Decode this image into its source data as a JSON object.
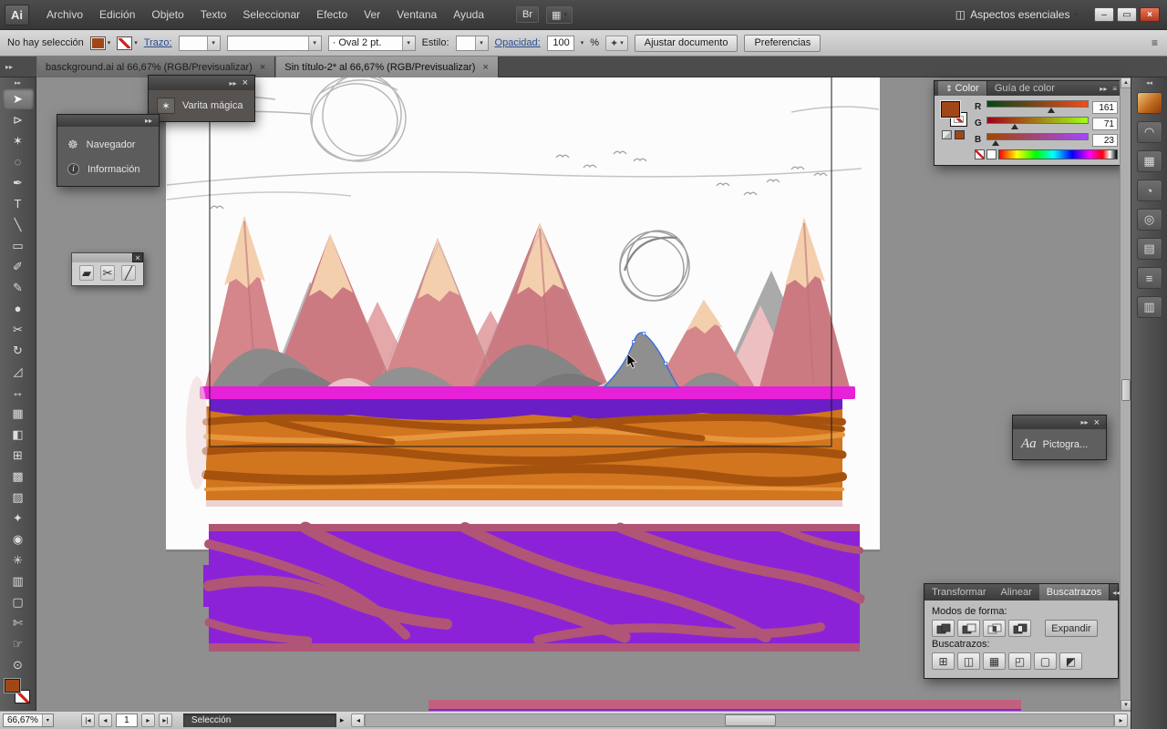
{
  "palette": {
    "magenta": "#e621d8",
    "purpleband": "#6a1ec6",
    "orange": "#d2751f",
    "orangedark": "#a5520e",
    "orangelight": "#e8963c",
    "rose": "#b15576",
    "purplerect": "#8c22d8",
    "bottompink": "#c2607e",
    "sel": "#3a6fd8",
    "fill": "#a14717",
    "mountain": "#d4868a",
    "mountaindark": "#cc7a82",
    "peach": "#f4cfae",
    "rock": "#8a8a8a"
  },
  "icons": {
    "chevrons_right": "▸▸",
    "chevrons_left": "◂◂",
    "close": "×",
    "menu": "≡",
    "arrow_down": "▾",
    "updown": "⇕",
    "wand": "✶",
    "wheel": "☸",
    "info": "i",
    "eraser": "▰",
    "scissors": "✂",
    "knife": "╱",
    "select_similar": "✦",
    "min": "–",
    "restore": "▭",
    "close_win": "×",
    "arrange": "▦",
    "workspace": "◫",
    "nav_first": "|◂",
    "nav_prev": "◂",
    "nav_next": "▸",
    "nav_last": "▸|",
    "up": "▲",
    "down": "▼",
    "left": "◂",
    "right": "▸"
  },
  "menubar": {
    "logo": "Ai",
    "items": [
      "Archivo",
      "Edición",
      "Objeto",
      "Texto",
      "Seleccionar",
      "Efecto",
      "Ver",
      "Ventana",
      "Ayuda"
    ],
    "bridge": "Br",
    "workspace": "Aspectos esenciales"
  },
  "controlbar": {
    "no_selection": "No hay selección",
    "stroke_label": "Trazo:",
    "brush_bullet": "·",
    "brush_value": "Oval 2 pt.",
    "style_label": "Estilo:",
    "opacity_label": "Opacidad:",
    "opacity_value": "100",
    "percent": "%",
    "fit_document": "Ajustar documento",
    "preferences": "Preferencias"
  },
  "tabs": {
    "tab1": "basckground.ai al 66,67% (RGB/Previsualizar)",
    "tab2": "Sin título-2* al 66,67% (RGB/Previsualizar)"
  },
  "toolbar": {
    "tools": [
      {
        "name": "selection-tool",
        "glyph": "➤"
      },
      {
        "name": "direct-selection-tool",
        "glyph": "⊳"
      },
      {
        "name": "magic-wand-tool",
        "glyph": "✶"
      },
      {
        "name": "lasso-tool",
        "glyph": "◌"
      },
      {
        "name": "pen-tool",
        "glyph": "✒"
      },
      {
        "name": "type-tool",
        "glyph": "T"
      },
      {
        "name": "line-segment-tool",
        "glyph": "╲"
      },
      {
        "name": "rectangle-tool",
        "glyph": "▭"
      },
      {
        "name": "paintbrush-tool",
        "glyph": "✐"
      },
      {
        "name": "pencil-tool",
        "glyph": "✎"
      },
      {
        "name": "blob-brush-tool",
        "glyph": "●"
      },
      {
        "name": "scissors-tool",
        "glyph": "✂"
      },
      {
        "name": "rotate-tool",
        "glyph": "↻"
      },
      {
        "name": "scale-tool",
        "glyph": "◿"
      },
      {
        "name": "width-tool",
        "glyph": "↔"
      },
      {
        "name": "free-transform-tool",
        "glyph": "▦"
      },
      {
        "name": "shape-builder-tool",
        "glyph": "◧"
      },
      {
        "name": "perspective-grid-tool",
        "glyph": "⊞"
      },
      {
        "name": "mesh-tool",
        "glyph": "▩"
      },
      {
        "name": "gradient-tool",
        "glyph": "▨"
      },
      {
        "name": "eyedropper-tool",
        "glyph": "✦"
      },
      {
        "name": "blend-tool",
        "glyph": "◉"
      },
      {
        "name": "symbol-sprayer-tool",
        "glyph": "✳"
      },
      {
        "name": "column-graph-tool",
        "glyph": "▥"
      },
      {
        "name": "artboard-tool",
        "glyph": "▢"
      },
      {
        "name": "slice-tool",
        "glyph": "✄"
      },
      {
        "name": "hand-tool",
        "glyph": "☞"
      },
      {
        "name": "zoom-tool",
        "glyph": "⊙"
      }
    ]
  },
  "dock": {
    "icons": [
      {
        "name": "color-panel-icon",
        "glyph": ""
      },
      {
        "name": "brushes-panel-icon",
        "glyph": "◠"
      },
      {
        "name": "swatches-panel-icon",
        "glyph": "▦"
      },
      {
        "name": "symbols-panel-icon",
        "glyph": "◔"
      },
      {
        "name": "stroke-panel-icon",
        "glyph": "◎"
      },
      {
        "name": "appearance-panel-icon",
        "glyph": "▤"
      },
      {
        "name": "layers-panel-icon",
        "glyph": "≡"
      },
      {
        "name": "gradient-panel-icon",
        "glyph": "▥"
      }
    ]
  },
  "panels": {
    "magic_wand": {
      "title": "Varita mágica"
    },
    "navigator": {
      "item1": "Navegador",
      "item2": "Información"
    },
    "glyphs_panel": {
      "icon": "Aa",
      "title": "Pictogra..."
    },
    "color": {
      "tab_color": "Color",
      "tab_guide": "Guía de color",
      "r": "R",
      "g": "G",
      "b": "B",
      "r_val": "161",
      "g_val": "71",
      "b_val": "23"
    },
    "pathfinder": {
      "tab1": "Transformar",
      "tab2": "Alinear",
      "tab3": "Buscatrazos",
      "shape_modes": "Modos de forma:",
      "expand": "Expandir",
      "pathfinders": "Buscatrazos:",
      "buttons": [
        {
          "name": "divide",
          "glyph": "⊞"
        },
        {
          "name": "trim",
          "glyph": "◫"
        },
        {
          "name": "merge",
          "glyph": "▦"
        },
        {
          "name": "crop",
          "glyph": "◰"
        },
        {
          "name": "outline",
          "glyph": "▢"
        },
        {
          "name": "minus-back",
          "glyph": "◩"
        }
      ]
    }
  },
  "statusbar": {
    "zoom": "66,67%",
    "page": "1",
    "tool": "Selección"
  }
}
